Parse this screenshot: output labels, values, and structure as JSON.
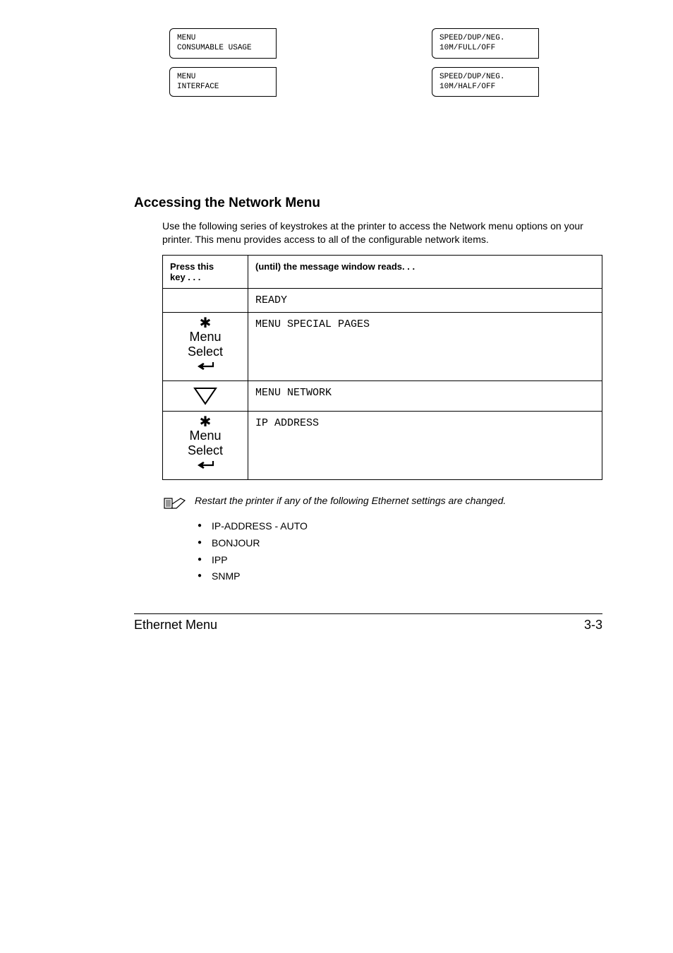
{
  "menuBoxes": {
    "left": [
      {
        "line1": "MENU",
        "line2": "CONSUMABLE USAGE"
      },
      {
        "line1": "MENU",
        "line2": "INTERFACE"
      }
    ],
    "right": [
      {
        "line1": "SPEED/DUP/NEG.",
        "line2": "10M/FULL/OFF"
      },
      {
        "line1": "SPEED/DUP/NEG.",
        "line2": "10M/HALF/OFF"
      }
    ]
  },
  "heading": "Accessing the Network Menu",
  "intro": "Use the following series of keystrokes at the printer to access the Network menu options on your printer. This menu provides access to all of the configurable network items.",
  "table": {
    "header": {
      "col1a": "Press this",
      "col1b": "key . . .",
      "col2": "(until) the message window reads. . ."
    },
    "rows": [
      {
        "key": "blank",
        "msg": "READY"
      },
      {
        "key": "menu-select",
        "msg": "MENU SPECIAL PAGES"
      },
      {
        "key": "down",
        "msg": "MENU NETWORK"
      },
      {
        "key": "menu-select",
        "msg": "IP ADDRESS"
      }
    ],
    "keyLabels": {
      "menu": "Menu",
      "select": "Select"
    }
  },
  "note": "Restart the printer if any of the following Ethernet settings are changed.",
  "bullets": [
    "IP-ADDRESS - AUTO",
    "BONJOUR",
    "IPP",
    "SNMP"
  ],
  "footer": {
    "left": "Ethernet Menu",
    "right": "3-3"
  }
}
